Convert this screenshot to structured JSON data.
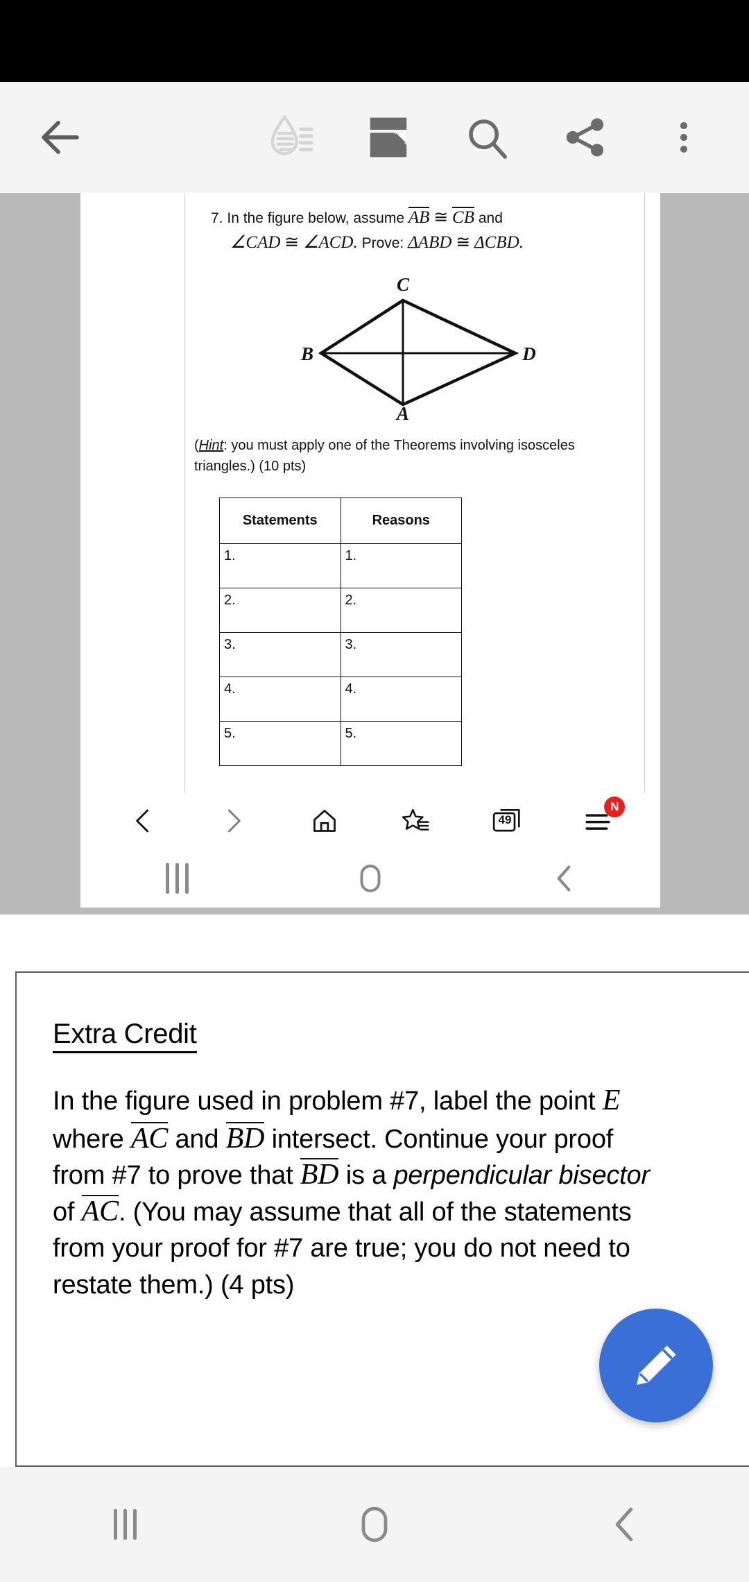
{
  "toolbar": {
    "back_label": "Back",
    "items": [
      {
        "name": "brightness-icon",
        "label": "Brightness",
        "state": "disabled"
      },
      {
        "name": "page-layout-icon",
        "label": "Page layout"
      },
      {
        "name": "search-icon",
        "label": "Find on page"
      },
      {
        "name": "share-icon",
        "label": "Share"
      },
      {
        "name": "overflow-menu-icon",
        "label": "More options"
      }
    ]
  },
  "document": {
    "problem_number": "7.",
    "line1_pre": "In the figure below, assume",
    "line1_seg_a": "AB",
    "line1_cong": "≅",
    "line1_seg_b": "CB",
    "line1_post": "and",
    "line2_angle1": "∠CAD",
    "line2_cong": "≅",
    "line2_angle2": "∠ACD.",
    "line2_prove": "Prove:",
    "line2_tri1": "ΔABD",
    "line2_cong2": "≅",
    "line2_tri2": "ΔCBD.",
    "figure": {
      "labels": {
        "top": "C",
        "left": "B",
        "right": "D",
        "bottom": "A"
      },
      "description": "rhombus B-C-D-A with diagonals AC and BD drawn"
    },
    "hint_open": "(",
    "hint_word": "Hint",
    "hint_text": ": you must apply one of the Theorems involving isosceles triangles.) (10 pts)",
    "table": {
      "headers": [
        "Statements",
        "Reasons"
      ],
      "rows": [
        [
          "1.",
          "1."
        ],
        [
          "2.",
          "2."
        ],
        [
          "3.",
          "3."
        ],
        [
          "4.",
          "4."
        ],
        [
          "5.",
          "5."
        ]
      ]
    }
  },
  "browser_bar": {
    "items": [
      {
        "name": "nav-back-icon",
        "label": "Back"
      },
      {
        "name": "nav-forward-icon",
        "label": "Forward"
      },
      {
        "name": "home-icon",
        "label": "Home"
      },
      {
        "name": "bookmarks-icon",
        "label": "Bookmarks"
      },
      {
        "name": "tabs-icon",
        "label": "Tabs",
        "count": "49"
      },
      {
        "name": "menu-icon",
        "label": "Menu",
        "badge": "N"
      }
    ]
  },
  "inner_nav": {
    "items": [
      {
        "name": "recents-icon",
        "label": "Recents"
      },
      {
        "name": "home-button-icon",
        "label": "Home"
      },
      {
        "name": "back-button-icon",
        "label": "Back"
      }
    ]
  },
  "extra_credit": {
    "title": "Extra Credit",
    "p1_pre": "In the figure used in problem #7, label the point",
    "p1_point": "E",
    "p2_pre": "where",
    "p2_seg_a": "AC",
    "p2_and": "and",
    "p2_seg_b": "BD",
    "p2_post": "intersect.  Continue your proof",
    "p3_pre": "from #7 to prove that",
    "p3_seg": "BD",
    "p3_mid": "is a",
    "p3_em": "perpendicular bisector",
    "p4_pre": "of",
    "p4_seg": "AC",
    "p4_post": ".  (You may assume that all of the statements",
    "p5": "from your proof for #7 are true; you do not need to",
    "p6": "restate them.) (4 pts)",
    "fab": {
      "name": "edit-pencil-icon",
      "label": "Edit",
      "color": "#3a6fd8"
    }
  },
  "system_nav": {
    "items": [
      {
        "name": "recents-icon",
        "label": "Recents"
      },
      {
        "name": "home-icon",
        "label": "Home"
      },
      {
        "name": "back-icon",
        "label": "Back"
      }
    ]
  },
  "colors": {
    "status_bar": "#000000",
    "toolbar_bg": "#f4f4f4",
    "page_backdrop": "#b9b9b9",
    "accent": "#3a6fd8",
    "badge_red": "#e8201c"
  }
}
